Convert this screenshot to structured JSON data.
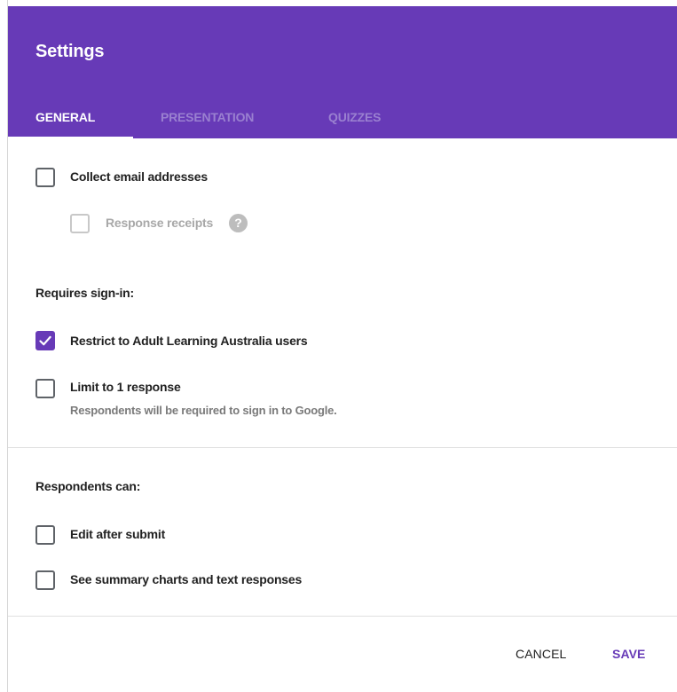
{
  "dialog": {
    "title": "Settings",
    "tabs": [
      {
        "label": "GENERAL",
        "active": true
      },
      {
        "label": "PRESENTATION",
        "active": false
      },
      {
        "label": "QUIZZES",
        "active": false
      }
    ],
    "accent_color": "#673ab7"
  },
  "general": {
    "collect_email": {
      "label": "Collect email addresses",
      "checked": false
    },
    "response_receipts": {
      "label": "Response receipts",
      "checked": false,
      "disabled": true,
      "help_icon": "question-circle-icon",
      "help_glyph": "?"
    },
    "requires_signin": {
      "heading": "Requires sign-in:",
      "restrict": {
        "label": "Restrict to Adult Learning Australia users",
        "checked": true
      },
      "limit": {
        "label": "Limit to 1 response",
        "checked": false,
        "hint": "Respondents will be required to sign in to Google."
      }
    },
    "respondents_can": {
      "heading": "Respondents can:",
      "edit_after_submit": {
        "label": "Edit after submit",
        "checked": false
      },
      "see_summary": {
        "label": "See summary charts and text responses",
        "checked": false
      }
    }
  },
  "actions": {
    "cancel_label": "CANCEL",
    "save_label": "SAVE"
  }
}
